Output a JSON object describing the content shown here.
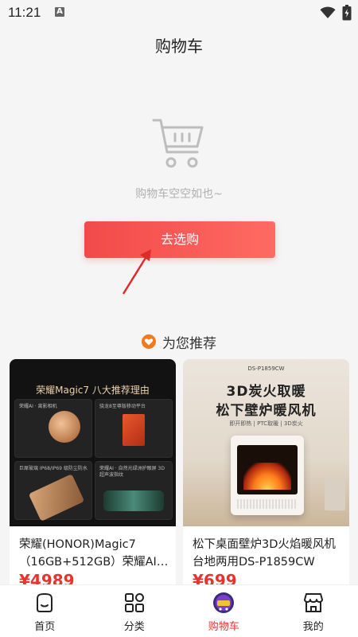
{
  "status_bar": {
    "time": "11:21",
    "notification_badge": "A"
  },
  "header": {
    "title": "购物车"
  },
  "cart": {
    "empty_text": "购物车空空如也~",
    "go_shop_label": "去选购"
  },
  "recommend": {
    "title": "为您推荐",
    "products": [
      {
        "name": "荣耀(HONOR)Magic7（16GB+512GB）荣耀AI…",
        "price": "¥4989",
        "image_title": "荣耀Magic7 八大推荐理由",
        "image_captions": [
          "荣耀AI · 离影相机",
          "骁龙8至尊版移动平台",
          "巨犀玻璃 IP68/IP69 级防尘防水",
          "荣耀AI · 自然光绿洲护眼屏 3D超声波指纹"
        ]
      },
      {
        "name": "松下桌面壁炉3D火焰暖风机台地两用DS-P1859CW",
        "price": "¥699",
        "image_model": "DS-P1859CW",
        "image_title_line1": "3D炭火取暖",
        "image_title_line2": "松下壁炉暖风机",
        "image_subtitle": "即开即热 | PTC取暖 | 3D炭火"
      }
    ]
  },
  "bottom_nav": {
    "items": [
      {
        "label": "首页",
        "icon": "home-icon"
      },
      {
        "label": "分类",
        "icon": "category-icon"
      },
      {
        "label": "购物车",
        "icon": "cart-icon",
        "active": true
      },
      {
        "label": "我的",
        "icon": "store-icon"
      }
    ]
  },
  "colors": {
    "accent": "#e8342f",
    "button_gradient_start": "#f24a4a",
    "button_gradient_end": "#ff6a63",
    "background": "#f5f5f5",
    "recommend_heart": "#f07a1f"
  }
}
